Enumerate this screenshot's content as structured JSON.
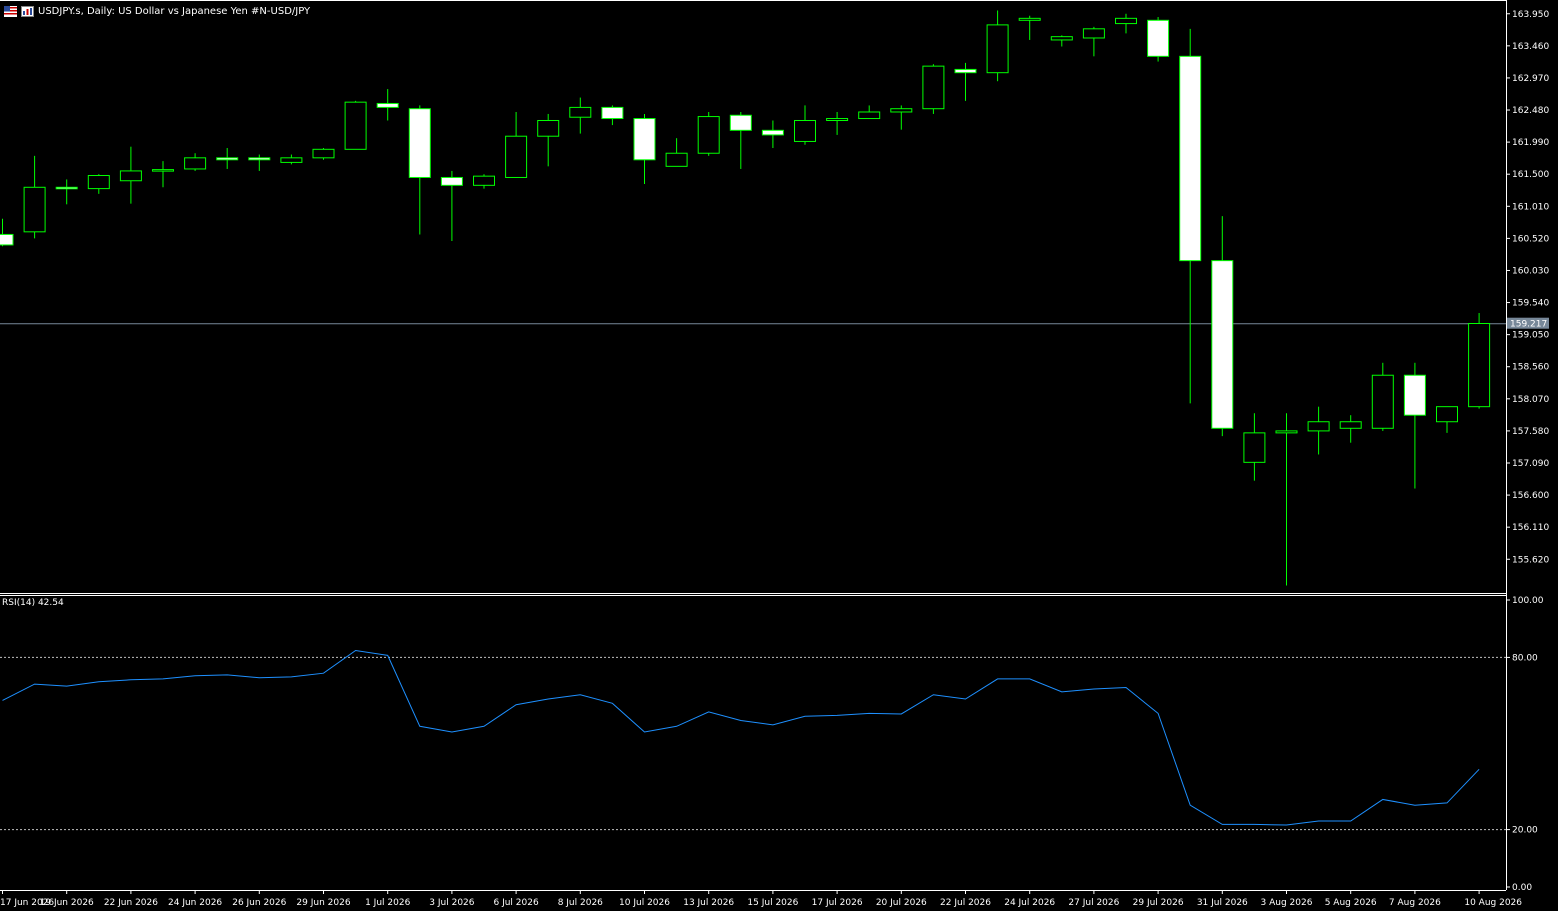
{
  "header": {
    "title": "USDJPY.s, Daily:  US Dollar vs  Japanese Yen #N-USD/JPY"
  },
  "rsi_panel": {
    "label": "RSI(14) 42.54"
  },
  "colors": {
    "background": "#000000",
    "bull_candle": "#00ff00",
    "bear_candle_fill": "#ffffff",
    "rsi_line": "#1e90ff",
    "bid_line": "#778899",
    "axis": "#ffffff"
  },
  "chart_data": [
    {
      "type": "candlestick",
      "title": "USDJPY.s, Daily:  US Dollar vs  Japanese Yen #N-USD/JPY",
      "x_tick_labels": [
        "17 Jun 2026",
        "19 Jun 2026",
        "22 Jun 2026",
        "24 Jun 2026",
        "26 Jun 2026",
        "29 Jun 2026",
        "1 Jul 2026",
        "3 Jul 2026",
        "6 Jul 2026",
        "8 Jul 2026",
        "10 Jul 2026",
        "13 Jul 2026",
        "15 Jul 2026",
        "17 Jul 2026",
        "20 Jul 2026",
        "22 Jul 2026",
        "24 Jul 2026",
        "27 Jul 2026",
        "29 Jul 2026",
        "31 Jul 2026",
        "3 Aug 2026",
        "5 Aug 2026",
        "7 Aug 2026",
        "10 Aug 2026"
      ],
      "y_tick_labels": [
        "163.950",
        "163.460",
        "162.970",
        "162.480",
        "161.990",
        "161.500",
        "161.010",
        "160.520",
        "160.030",
        "159.540",
        "159.050",
        "158.560",
        "158.070",
        "157.580",
        "157.090",
        "156.600",
        "156.110",
        "155.620"
      ],
      "ylim": [
        155.12,
        164.16
      ],
      "current_price_label": "159.217",
      "current_price": 159.217,
      "grid": false,
      "candles": [
        {
          "o": 160.58,
          "h": 160.82,
          "l": 160.4,
          "c": 160.42
        },
        {
          "o": 160.62,
          "h": 161.78,
          "l": 160.52,
          "c": 161.3
        },
        {
          "o": 161.3,
          "h": 161.42,
          "l": 161.04,
          "c": 161.28
        },
        {
          "o": 161.28,
          "h": 161.5,
          "l": 161.2,
          "c": 161.48
        },
        {
          "o": 161.4,
          "h": 161.92,
          "l": 161.05,
          "c": 161.55
        },
        {
          "o": 161.55,
          "h": 161.7,
          "l": 161.3,
          "c": 161.57
        },
        {
          "o": 161.58,
          "h": 161.82,
          "l": 161.55,
          "c": 161.75
        },
        {
          "o": 161.75,
          "h": 161.9,
          "l": 161.58,
          "c": 161.72
        },
        {
          "o": 161.75,
          "h": 161.8,
          "l": 161.55,
          "c": 161.72
        },
        {
          "o": 161.68,
          "h": 161.8,
          "l": 161.65,
          "c": 161.75
        },
        {
          "o": 161.75,
          "h": 161.9,
          "l": 161.72,
          "c": 161.88
        },
        {
          "o": 161.88,
          "h": 162.62,
          "l": 161.88,
          "c": 162.6
        },
        {
          "o": 162.58,
          "h": 162.8,
          "l": 162.32,
          "c": 162.52
        },
        {
          "o": 162.5,
          "h": 162.55,
          "l": 160.58,
          "c": 161.45
        },
        {
          "o": 161.45,
          "h": 161.55,
          "l": 160.48,
          "c": 161.33
        },
        {
          "o": 161.33,
          "h": 161.5,
          "l": 161.28,
          "c": 161.47
        },
        {
          "o": 161.45,
          "h": 162.45,
          "l": 161.45,
          "c": 162.08
        },
        {
          "o": 162.08,
          "h": 162.42,
          "l": 161.62,
          "c": 162.32
        },
        {
          "o": 162.37,
          "h": 162.67,
          "l": 162.12,
          "c": 162.52
        },
        {
          "o": 162.52,
          "h": 162.55,
          "l": 162.25,
          "c": 162.35
        },
        {
          "o": 162.35,
          "h": 162.42,
          "l": 161.35,
          "c": 161.72
        },
        {
          "o": 161.62,
          "h": 162.05,
          "l": 161.62,
          "c": 161.82
        },
        {
          "o": 161.82,
          "h": 162.45,
          "l": 161.78,
          "c": 162.38
        },
        {
          "o": 162.4,
          "h": 162.45,
          "l": 161.58,
          "c": 162.17
        },
        {
          "o": 162.17,
          "h": 162.32,
          "l": 161.9,
          "c": 162.1
        },
        {
          "o": 162.0,
          "h": 162.55,
          "l": 161.95,
          "c": 162.32
        },
        {
          "o": 162.32,
          "h": 162.45,
          "l": 162.1,
          "c": 162.35
        },
        {
          "o": 162.35,
          "h": 162.55,
          "l": 162.35,
          "c": 162.45
        },
        {
          "o": 162.45,
          "h": 162.55,
          "l": 162.18,
          "c": 162.5
        },
        {
          "o": 162.5,
          "h": 163.18,
          "l": 162.42,
          "c": 163.15
        },
        {
          "o": 163.1,
          "h": 163.2,
          "l": 162.62,
          "c": 163.05
        },
        {
          "o": 163.05,
          "h": 164.0,
          "l": 162.92,
          "c": 163.78
        },
        {
          "o": 163.85,
          "h": 163.92,
          "l": 163.55,
          "c": 163.88
        },
        {
          "o": 163.55,
          "h": 163.62,
          "l": 163.45,
          "c": 163.6
        },
        {
          "o": 163.58,
          "h": 163.75,
          "l": 163.3,
          "c": 163.72
        },
        {
          "o": 163.8,
          "h": 163.95,
          "l": 163.65,
          "c": 163.88
        },
        {
          "o": 163.85,
          "h": 163.9,
          "l": 163.22,
          "c": 163.3
        },
        {
          "o": 163.3,
          "h": 163.72,
          "l": 158.0,
          "c": 160.18
        },
        {
          "o": 160.18,
          "h": 160.86,
          "l": 157.5,
          "c": 157.62
        },
        {
          "o": 157.1,
          "h": 157.85,
          "l": 156.82,
          "c": 157.55
        },
        {
          "o": 157.55,
          "h": 157.85,
          "l": 155.22,
          "c": 157.58
        },
        {
          "o": 157.58,
          "h": 157.95,
          "l": 157.22,
          "c": 157.72
        },
        {
          "o": 157.62,
          "h": 157.82,
          "l": 157.4,
          "c": 157.72
        },
        {
          "o": 157.62,
          "h": 158.62,
          "l": 157.58,
          "c": 158.43
        },
        {
          "o": 158.43,
          "h": 158.62,
          "l": 156.7,
          "c": 157.82
        },
        {
          "o": 157.72,
          "h": 157.95,
          "l": 157.55,
          "c": 157.95
        },
        {
          "o": 157.95,
          "h": 159.38,
          "l": 157.92,
          "c": 159.22
        }
      ]
    },
    {
      "type": "line",
      "title": "RSI(14) 42.54",
      "ylim": [
        0,
        100
      ],
      "y_tick_labels": [
        "100.00",
        "80.00",
        "20.00",
        "0.00"
      ],
      "levels": [
        80,
        20
      ],
      "series": [
        {
          "values": [
            65.0,
            70.7,
            70.0,
            71.5,
            72.2,
            72.5,
            73.6,
            73.9,
            72.9,
            73.2,
            74.5,
            82.4,
            80.7,
            56.0,
            54.0,
            56.0,
            63.5,
            65.5,
            67.0,
            64.0,
            54.0,
            56.0,
            61.0,
            58.0,
            56.5,
            59.5,
            59.8,
            60.5,
            60.3,
            67.0,
            65.5,
            72.5,
            72.5,
            68.0,
            69.0,
            69.5,
            60.5,
            28.5,
            21.8,
            21.8,
            21.6,
            23.0,
            23.0,
            30.5,
            28.5,
            29.3,
            41.0
          ]
        }
      ]
    }
  ]
}
